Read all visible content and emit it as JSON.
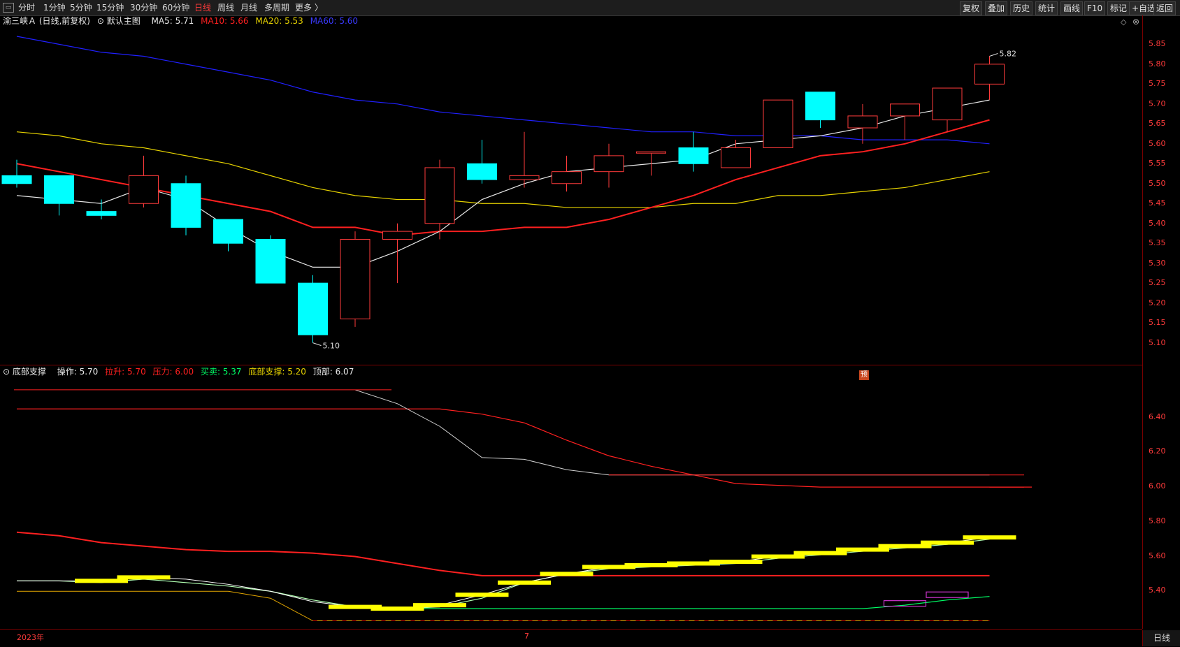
{
  "toolbar": {
    "left_items": [
      {
        "label": "分时",
        "active": false
      },
      {
        "label": "1分钟",
        "active": false
      },
      {
        "label": "5分钟",
        "active": false
      },
      {
        "label": "15分钟",
        "active": false
      },
      {
        "label": "30分钟",
        "active": false
      },
      {
        "label": "60分钟",
        "active": false
      },
      {
        "label": "日线",
        "active": true
      },
      {
        "label": "周线",
        "active": false
      },
      {
        "label": "月线",
        "active": false
      },
      {
        "label": "多周期",
        "active": false
      },
      {
        "label": "更多 〉",
        "active": false
      }
    ],
    "right_items": [
      "复权",
      "叠加",
      "历史",
      "统计",
      "画线",
      "F10",
      "标记",
      "+自选",
      "返回"
    ]
  },
  "main_header": {
    "stock": "渝三峡Ａ (日线,前复权)",
    "mode": "默认主图",
    "ma5": "MA5: 5.71",
    "ma10": "MA10: 5.66",
    "ma20": "MA20: 5.53",
    "ma60": "MA60: 5.60"
  },
  "indicator_header": {
    "name": "底部支撑",
    "op": "操作: 5.70",
    "pull": "拉升: 5.70",
    "pressure": "压力: 6.00",
    "buysell": "买卖: 5.37",
    "bottom": "底部支撑: 5.20",
    "top": "顶部: 6.07"
  },
  "colors": {
    "up": "#ff3b3b",
    "down": "#00ffff",
    "ma5": "#e8e8e8",
    "ma10": "#ff2020",
    "ma20": "#e6d200",
    "ma60": "#2020ff",
    "axis": "#ff3b3b",
    "yellow": "#ffff00",
    "green": "#00ff66",
    "magenta": "#cc33cc"
  },
  "chart_data": [
    {
      "type": "candlestick",
      "title": "渝三峡Ａ (日线,前复权)",
      "y_ticks": [
        "5.85",
        "5.80",
        "5.75",
        "5.70",
        "5.65",
        "5.60",
        "5.55",
        "5.50",
        "5.45",
        "5.40",
        "5.35",
        "5.30",
        "5.25",
        "5.20",
        "5.15",
        "5.10"
      ],
      "ylim": [
        5.08,
        5.87
      ],
      "candles": [
        {
          "o": 5.52,
          "h": 5.56,
          "l": 5.49,
          "c": 5.5
        },
        {
          "o": 5.52,
          "h": 5.52,
          "l": 5.42,
          "c": 5.45
        },
        {
          "o": 5.43,
          "h": 5.46,
          "l": 5.41,
          "c": 5.42
        },
        {
          "o": 5.45,
          "h": 5.57,
          "l": 5.44,
          "c": 5.52
        },
        {
          "o": 5.5,
          "h": 5.52,
          "l": 5.37,
          "c": 5.39
        },
        {
          "o": 5.41,
          "h": 5.41,
          "l": 5.33,
          "c": 5.35
        },
        {
          "o": 5.36,
          "h": 5.37,
          "l": 5.25,
          "c": 5.25
        },
        {
          "o": 5.25,
          "h": 5.27,
          "l": 5.1,
          "c": 5.12
        },
        {
          "o": 5.16,
          "h": 5.38,
          "l": 5.14,
          "c": 5.36
        },
        {
          "o": 5.36,
          "h": 5.4,
          "l": 5.25,
          "c": 5.38
        },
        {
          "o": 5.4,
          "h": 5.56,
          "l": 5.36,
          "c": 5.54
        },
        {
          "o": 5.55,
          "h": 5.61,
          "l": 5.5,
          "c": 5.51
        },
        {
          "o": 5.51,
          "h": 5.63,
          "l": 5.49,
          "c": 5.52
        },
        {
          "o": 5.5,
          "h": 5.57,
          "l": 5.48,
          "c": 5.53
        },
        {
          "o": 5.53,
          "h": 5.6,
          "l": 5.49,
          "c": 5.57
        },
        {
          "o": 5.58,
          "h": 5.58,
          "l": 5.52,
          "c": 5.58
        },
        {
          "o": 5.59,
          "h": 5.63,
          "l": 5.53,
          "c": 5.55
        },
        {
          "o": 5.54,
          "h": 5.61,
          "l": 5.54,
          "c": 5.59
        },
        {
          "o": 5.59,
          "h": 5.71,
          "l": 5.59,
          "c": 5.71
        },
        {
          "o": 5.73,
          "h": 5.73,
          "l": 5.64,
          "c": 5.66
        },
        {
          "o": 5.64,
          "h": 5.7,
          "l": 5.6,
          "c": 5.67
        },
        {
          "o": 5.67,
          "h": 5.7,
          "l": 5.61,
          "c": 5.7
        },
        {
          "o": 5.66,
          "h": 5.74,
          "l": 5.63,
          "c": 5.74
        },
        {
          "o": 5.75,
          "h": 5.82,
          "l": 5.71,
          "c": 5.8
        }
      ],
      "ma5": [
        5.47,
        5.46,
        5.45,
        5.49,
        5.46,
        5.39,
        5.33,
        5.29,
        5.29,
        5.33,
        5.38,
        5.46,
        5.5,
        5.53,
        5.54,
        5.55,
        5.56,
        5.6,
        5.61,
        5.62,
        5.64,
        5.67,
        5.69,
        5.71
      ],
      "ma10": [
        5.55,
        5.53,
        5.51,
        5.49,
        5.47,
        5.45,
        5.43,
        5.39,
        5.39,
        5.37,
        5.38,
        5.38,
        5.39,
        5.39,
        5.41,
        5.44,
        5.47,
        5.51,
        5.54,
        5.57,
        5.58,
        5.6,
        5.63,
        5.66
      ],
      "ma20": [
        5.63,
        5.62,
        5.6,
        5.59,
        5.57,
        5.55,
        5.52,
        5.49,
        5.47,
        5.46,
        5.46,
        5.45,
        5.45,
        5.44,
        5.44,
        5.44,
        5.45,
        5.45,
        5.47,
        5.47,
        5.48,
        5.49,
        5.51,
        5.53
      ],
      "ma60": [
        5.87,
        5.85,
        5.83,
        5.82,
        5.8,
        5.78,
        5.76,
        5.73,
        5.71,
        5.7,
        5.68,
        5.67,
        5.66,
        5.65,
        5.64,
        5.63,
        5.63,
        5.62,
        5.62,
        5.62,
        5.61,
        5.61,
        5.61,
        5.6
      ],
      "annotations": [
        {
          "label": "5.82",
          "kind": "high"
        },
        {
          "label": "5.10",
          "kind": "low"
        }
      ],
      "badge": "预"
    },
    {
      "type": "line",
      "title": "底部支撑",
      "y_ticks": [
        "6.40",
        "6.20",
        "6.00",
        "5.80",
        "5.60",
        "5.40"
      ],
      "ylim": [
        5.22,
        6.62
      ],
      "series": [
        {
          "name": "压力",
          "values": [
            6.45,
            6.45,
            6.45,
            6.45,
            6.45,
            6.45,
            6.45,
            6.45,
            6.45,
            6.45,
            6.45,
            6.42,
            6.37,
            6.27,
            6.18,
            6.12,
            6.07,
            6.02,
            6.01,
            6.0,
            6.0,
            6.0,
            6.0,
            6.0
          ]
        },
        {
          "name": "顶部",
          "values": [
            null,
            null,
            null,
            null,
            null,
            null,
            null,
            null,
            6.56,
            6.48,
            6.35,
            6.17,
            6.16,
            6.1,
            6.07,
            6.07,
            6.07,
            6.07,
            6.07,
            6.07,
            6.07,
            6.07,
            6.07,
            6.07
          ]
        },
        {
          "name": "买卖",
          "values": [
            5.46,
            5.46,
            5.45,
            5.47,
            5.45,
            5.43,
            5.4,
            5.35,
            5.31,
            5.3,
            5.31,
            5.36,
            5.45,
            5.5,
            5.53,
            5.54,
            5.55,
            5.56,
            5.59,
            5.61,
            5.63,
            5.65,
            5.67,
            5.7
          ]
        },
        {
          "name": "操作",
          "values": [
            5.46,
            5.46,
            5.46,
            5.48,
            5.47,
            5.44,
            5.4,
            5.34,
            5.31,
            5.3,
            5.32,
            5.38,
            5.45,
            5.5,
            5.54,
            5.55,
            5.56,
            5.57,
            5.6,
            5.62,
            5.64,
            5.66,
            5.68,
            5.71
          ]
        },
        {
          "name": "拉升",
          "values": [
            5.74,
            5.72,
            5.68,
            5.66,
            5.64,
            5.63,
            5.63,
            5.62,
            5.6,
            5.56,
            5.52,
            5.49,
            5.49,
            5.49,
            5.49,
            5.49,
            5.49,
            5.49,
            5.49,
            5.49,
            5.49,
            5.49,
            5.49,
            5.49
          ]
        },
        {
          "name": "底部支撑",
          "values": [
            5.4,
            5.4,
            5.4,
            5.4,
            5.4,
            5.4,
            5.36,
            5.23,
            5.23,
            5.23,
            5.23,
            5.23,
            5.23,
            5.23,
            5.23,
            5.23,
            5.23,
            5.23,
            5.23,
            5.23,
            5.23,
            5.23,
            5.23,
            5.23
          ]
        },
        {
          "name": "绿线",
          "values": [
            null,
            null,
            null,
            null,
            null,
            null,
            null,
            null,
            5.31,
            5.3,
            5.3,
            5.3,
            5.3,
            5.3,
            5.3,
            5.3,
            5.3,
            5.3,
            5.3,
            5.3,
            5.3,
            5.32,
            5.35,
            5.37
          ]
        }
      ]
    }
  ],
  "bottom": {
    "date_start": "2023年",
    "date_mid": "7",
    "view": "日线"
  }
}
